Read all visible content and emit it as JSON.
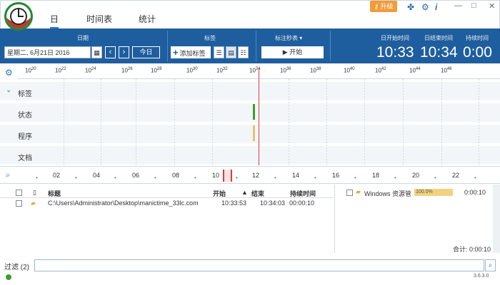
{
  "tabs": [
    "日",
    "时间表",
    "统计"
  ],
  "topbar": {
    "upgrade_label": "升级",
    "icons": [
      "puzzle-icon",
      "gear-icon",
      "info-icon"
    ],
    "window_buttons": [
      "—",
      "□",
      "✕"
    ]
  },
  "toolbar": {
    "date_title": "日期",
    "date_value": "星期二, 6月21日 2016",
    "prev_label": "‹",
    "next_label": "›",
    "today_label": "今日",
    "tag_title": "标签",
    "add_tag_label": "添加标签",
    "stopwatch_title": "标注秒表 ▾",
    "start_label": "开始",
    "start_time_title": "日开始时间",
    "start_time": "10:33",
    "end_time_title": "日结束时间",
    "end_time": "10:34",
    "duration_title": "持续时间",
    "duration": "0:00"
  },
  "ruler": {
    "labels": [
      "10",
      "20",
      "10",
      "22",
      "10",
      "24",
      "10",
      "26",
      "10",
      "28",
      "10",
      "30",
      "10",
      "32",
      "10",
      "34",
      "10",
      "36",
      "10",
      "38",
      "10",
      "40",
      "10",
      "42",
      "10",
      "44",
      "10",
      "46"
    ]
  },
  "rows": [
    "标签",
    "状态",
    "程序",
    "文档"
  ],
  "overview": {
    "labels": [
      "02",
      "04",
      "06",
      "08",
      "10",
      "12",
      "14",
      "16",
      "18",
      "20",
      "22"
    ]
  },
  "table": {
    "headers": [
      "标题",
      "开始",
      "结束",
      "持续时间"
    ],
    "row": {
      "title": "C:\\Users\\Administrator\\Desktop\\manictime_33lc.com",
      "start": "10:33:53",
      "end": "10:34:03",
      "duration": "00:00:10"
    }
  },
  "right_pane": {
    "app_name": "Windows 资源管",
    "percent": "100.0%",
    "duration": "0:00:10",
    "total": "合计: 0:00:10"
  },
  "filter": {
    "label": "过滤",
    "count": "(2)"
  },
  "version": "3.6.3.0"
}
